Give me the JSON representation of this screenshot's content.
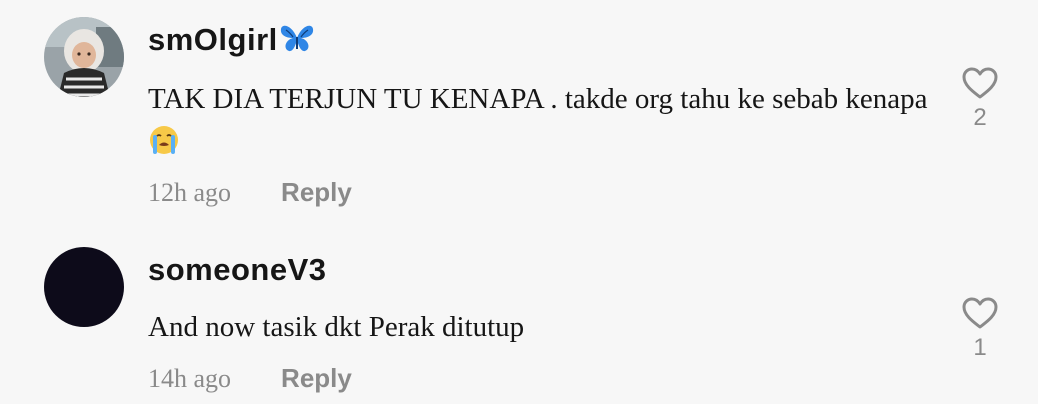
{
  "comments": [
    {
      "username": "smOlgirl",
      "username_icon": "blue-butterfly-emoji",
      "text": "TAK DIA TERJUN TU KENAPA . takde org tahu ke sebab kenapa",
      "text_emoji": "loudly-crying-face-emoji",
      "time": "12h ago",
      "reply_label": "Reply",
      "like_count": "2",
      "avatar": "photo-avatar"
    },
    {
      "username": "someoneV3",
      "text": "And now tasik dkt Perak ditutup",
      "time": "14h ago",
      "reply_label": "Reply",
      "like_count": "1",
      "avatar": "dark-avatar"
    }
  ],
  "colors": {
    "background": "#f7f7f7",
    "text": "#161616",
    "muted": "#8a8a8a",
    "avatar_dark": "#0d0b1a"
  }
}
